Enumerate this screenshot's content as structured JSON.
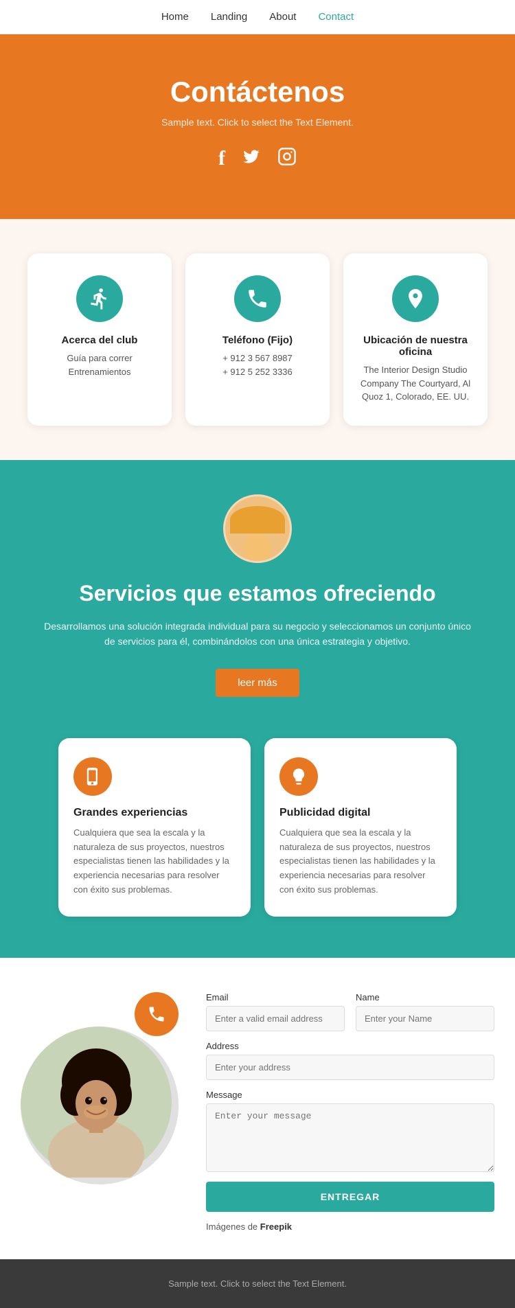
{
  "nav": {
    "items": [
      {
        "label": "Home",
        "active": false
      },
      {
        "label": "Landing",
        "active": false
      },
      {
        "label": "About",
        "active": false
      },
      {
        "label": "Contact",
        "active": true
      }
    ]
  },
  "hero": {
    "title": "Contáctenos",
    "subtitle": "Sample text. Click to select the Text Element.",
    "social": [
      "facebook",
      "twitter",
      "instagram"
    ]
  },
  "cards": [
    {
      "icon": "run",
      "title": "Acerca del club",
      "lines": [
        "Guía para correr",
        "Entrenamientos"
      ]
    },
    {
      "icon": "phone",
      "title": "Teléfono (Fijo)",
      "lines": [
        "+ 912 3 567 8987",
        "+ 912 5 252 3336"
      ]
    },
    {
      "icon": "location",
      "title": "Ubicación de nuestra oficina",
      "lines": [
        "The Interior Design Studio Company The Courtyard, Al Quoz 1, Colorado, EE. UU."
      ]
    }
  ],
  "services": {
    "title": "Servicios que estamos ofreciendo",
    "description": "Desarrollamos una solución integrada individual para su negocio y seleccionamos un conjunto único de servicios para él, combinándolos con una única estrategia y objetivo.",
    "button_label": "leer más",
    "cards": [
      {
        "icon": "mobile",
        "title": "Grandes experiencias",
        "description": "Cualquiera que sea la escala y la naturaleza de sus proyectos, nuestros especialistas tienen las habilidades y la experiencia necesarias para resolver con éxito sus problemas."
      },
      {
        "icon": "bulb",
        "title": "Publicidad digital",
        "description": "Cualquiera que sea la escala y la naturaleza de sus proyectos, nuestros especialistas tienen las habilidades y la experiencia necesarias para resolver con éxito sus problemas."
      }
    ]
  },
  "contact_form": {
    "email_label": "Email",
    "email_placeholder": "Enter a valid email address",
    "name_label": "Name",
    "name_placeholder": "Enter your Name",
    "address_label": "Address",
    "address_placeholder": "Enter your address",
    "message_label": "Message",
    "message_placeholder": "Enter your message",
    "submit_label": "ENTREGAR",
    "freepik_text": "Imágenes de",
    "freepik_link": "Freepik"
  },
  "footer": {
    "text": "Sample text. Click to select the Text Element."
  }
}
